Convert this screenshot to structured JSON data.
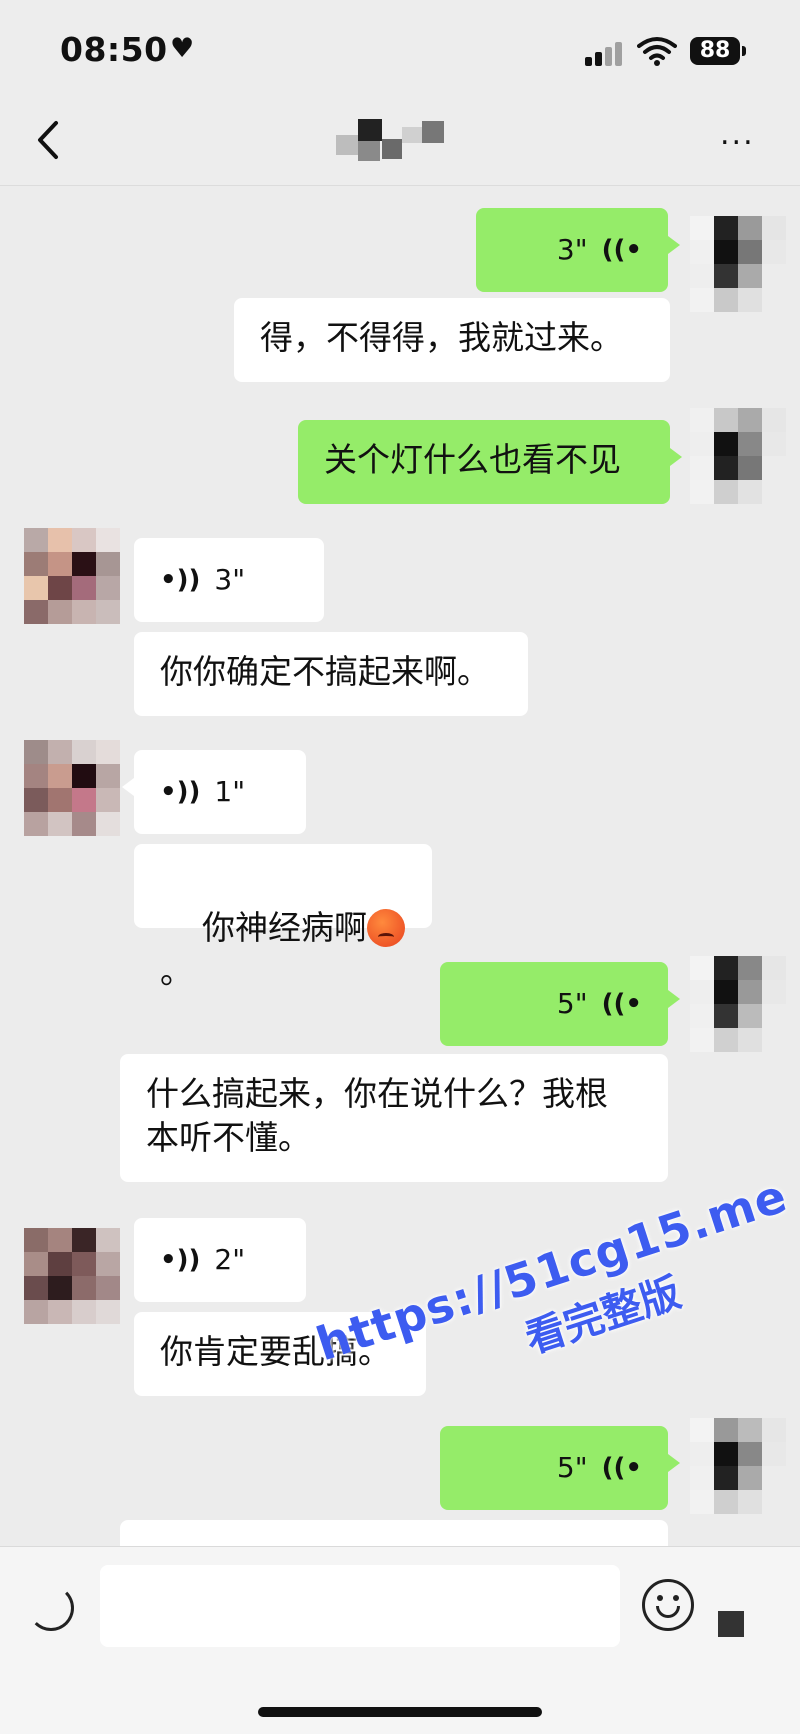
{
  "status_bar": {
    "time": "08:50",
    "battery": "88"
  },
  "header": {
    "more_label": "..."
  },
  "messages": [
    {
      "side": "right",
      "voice_duration": "3\""
    },
    {
      "side": "right",
      "text": "得，不得得，我就过来。"
    },
    {
      "side": "right",
      "text": "关个灯什么也看不见"
    },
    {
      "side": "left",
      "voice_duration": "3\""
    },
    {
      "side": "left",
      "text": "你你确定不搞起来啊。"
    },
    {
      "side": "left",
      "voice_duration": "1\""
    },
    {
      "side": "left",
      "text": "你神经病啊",
      "suffix": "。",
      "emoji": "angry-face"
    },
    {
      "side": "right",
      "voice_duration": "5\""
    },
    {
      "side": "right",
      "text": "什么搞起来，你在说什么？我根\n本听不懂。"
    },
    {
      "side": "left",
      "voice_duration": "2\""
    },
    {
      "side": "left",
      "text": "你肯定要乱搞。"
    },
    {
      "side": "right",
      "voice_duration": "5\""
    }
  ],
  "watermark": {
    "line1": "https://51cg15.me",
    "line2": "看完整版"
  },
  "input_bar": {
    "placeholder": ""
  },
  "colors": {
    "outgoing_bubble": "#95ec69",
    "incoming_bubble": "#ffffff",
    "chat_background": "#ececec",
    "watermark": "#3d5cf0"
  },
  "icons": [
    "heart-icon",
    "signal-icon",
    "wifi-icon",
    "battery-icon",
    "back-chevron-icon",
    "more-icon",
    "voice-wave-icon",
    "voice-toggle-icon",
    "emoji-icon",
    "plus-icon"
  ]
}
